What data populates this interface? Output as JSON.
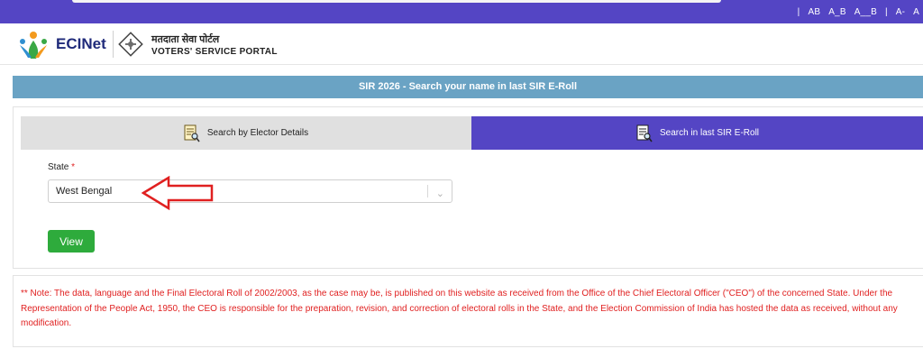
{
  "topbar": {
    "links": [
      "|",
      "AB",
      "A_B",
      "A__B",
      "|",
      "A-",
      "A"
    ],
    "color": "#5445c4"
  },
  "header": {
    "logo_text": "ECINet",
    "portal_hindi": "मतदाता सेवा पोर्टल",
    "portal_english": "VOTERS' SERVICE PORTAL"
  },
  "banner": {
    "title": "SIR 2026 - Search your name in last SIR E-Roll",
    "color": "#6aa3c4"
  },
  "tabs": [
    {
      "label": "Search by Elector Details",
      "icon": "document-search-icon",
      "active": false
    },
    {
      "label": "Search in last SIR E-Roll",
      "icon": "document-search-icon",
      "active": true
    }
  ],
  "form": {
    "state_label": "State",
    "required_mark": "*",
    "state_value": "West Bengal",
    "view_label": "View",
    "button_color": "#2eab3c"
  },
  "annotation": {
    "icon": "red-arrow-icon",
    "color": "#e02020"
  },
  "note": {
    "text": "** Note: The data, language and the Final Electoral Roll of 2002/2003, as the case may be, is published on this website as received from the Office of the Chief Electoral Officer (\"CEO\") of the concerned State. Under the Representation of the People Act, 1950, the CEO is responsible for the preparation, revision, and correction of electoral rolls in the State, and the Election Commission of India has hosted the data as received, without any modification.",
    "color": "#e02020"
  }
}
